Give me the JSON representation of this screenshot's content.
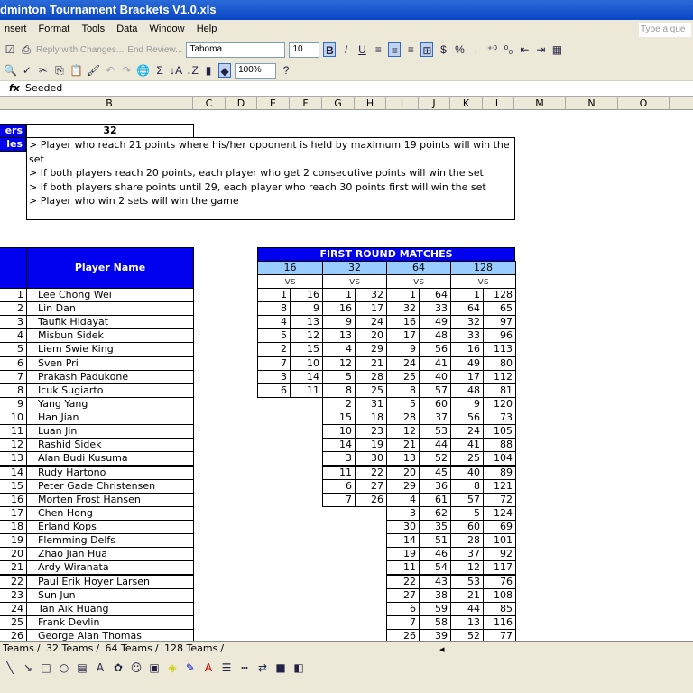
{
  "window": {
    "title": "dminton Tournament Brackets V1.0.xls",
    "help_placeholder": "Type a que"
  },
  "menu": [
    "nsert",
    "Format",
    "Tools",
    "Data",
    "Window",
    "Help"
  ],
  "toolbar": {
    "reply": "Reply with Changes...",
    "end_review": "End Review...",
    "font": "Tahoma",
    "size": "10",
    "zoom": "100%"
  },
  "formula_bar": {
    "fx": "fx",
    "value": "Seeded"
  },
  "columns": [
    "B",
    "C",
    "D",
    "E",
    "F",
    "G",
    "H",
    "I",
    "J",
    "K",
    "L",
    "M",
    "N",
    "O"
  ],
  "players_label": "ers",
  "players_value": "32",
  "rules_label": "les",
  "rules": [
    "> Player who reach 21 points where his/her opponent is held by maximum 19 points will win the set",
    "> If both players reach 20 points, each player who get 2 consecutive points will win the set",
    "> If both players share points until 29, each player who reach 30 points first will win the set",
    "> Player who win 2 sets will win the game"
  ],
  "player_header": "Player Name",
  "players": [
    "Lee Chong Wei",
    "Lin Dan",
    "Taufik Hidayat",
    "Misbun Sidek",
    "Liem Swie King",
    "Sven Pri",
    "Prakash Padukone",
    "Icuk Sugiarto",
    "Yang Yang",
    "Han Jian",
    "Luan Jin",
    "Rashid Sidek",
    "Alan Budi Kusuma",
    "Rudy Hartono",
    "Peter Gade Christensen",
    "Morten Frost Hansen",
    "Chen Hong",
    "Erland Kops",
    "Flemming Delfs",
    "Zhao Jian Hua",
    "Ardy Wiranata",
    "Paul Erik Hoyer Larsen",
    "Sun Jun",
    "Tan Aik Huang",
    "Frank Devlin",
    "George Alan Thomas"
  ],
  "matches": {
    "title": "FIRST ROUND MATCHES",
    "vs": "vs",
    "groups": [
      {
        "label": "16",
        "pairs": [
          [
            1,
            16
          ],
          [
            8,
            9
          ],
          [
            4,
            13
          ],
          [
            5,
            12
          ],
          [
            2,
            15
          ],
          [
            7,
            10
          ],
          [
            3,
            14
          ],
          [
            6,
            11
          ]
        ]
      },
      {
        "label": "32",
        "pairs": [
          [
            1,
            32
          ],
          [
            16,
            17
          ],
          [
            9,
            24
          ],
          [
            13,
            20
          ],
          [
            4,
            29
          ],
          [
            12,
            21
          ],
          [
            5,
            28
          ],
          [
            8,
            25
          ],
          [
            2,
            31
          ],
          [
            15,
            18
          ],
          [
            10,
            23
          ],
          [
            14,
            19
          ],
          [
            3,
            30
          ],
          [
            11,
            22
          ],
          [
            6,
            27
          ],
          [
            7,
            26
          ]
        ]
      },
      {
        "label": "64",
        "pairs": [
          [
            1,
            64
          ],
          [
            32,
            33
          ],
          [
            16,
            49
          ],
          [
            17,
            48
          ],
          [
            9,
            56
          ],
          [
            24,
            41
          ],
          [
            25,
            40
          ],
          [
            8,
            57
          ],
          [
            5,
            60
          ],
          [
            28,
            37
          ],
          [
            12,
            53
          ],
          [
            21,
            44
          ],
          [
            13,
            52
          ],
          [
            20,
            45
          ],
          [
            29,
            36
          ],
          [
            4,
            61
          ],
          [
            3,
            62
          ],
          [
            30,
            35
          ],
          [
            14,
            51
          ],
          [
            19,
            46
          ],
          [
            11,
            54
          ],
          [
            22,
            43
          ],
          [
            27,
            38
          ],
          [
            6,
            59
          ],
          [
            7,
            58
          ],
          [
            26,
            39
          ]
        ]
      },
      {
        "label": "128",
        "pairs": [
          [
            1,
            128
          ],
          [
            64,
            65
          ],
          [
            32,
            97
          ],
          [
            33,
            96
          ],
          [
            16,
            113
          ],
          [
            49,
            80
          ],
          [
            17,
            112
          ],
          [
            48,
            81
          ],
          [
            9,
            120
          ],
          [
            56,
            73
          ],
          [
            24,
            105
          ],
          [
            41,
            88
          ],
          [
            25,
            104
          ],
          [
            40,
            89
          ],
          [
            8,
            121
          ],
          [
            57,
            72
          ],
          [
            5,
            124
          ],
          [
            60,
            69
          ],
          [
            28,
            101
          ],
          [
            37,
            92
          ],
          [
            12,
            117
          ],
          [
            53,
            76
          ],
          [
            21,
            108
          ],
          [
            44,
            85
          ],
          [
            13,
            116
          ],
          [
            52,
            77
          ]
        ]
      }
    ]
  },
  "sheet_tabs": [
    "Teams",
    "32 Teams",
    "64 Teams",
    "128 Teams"
  ],
  "colors": {
    "header_blue": "#0000ee",
    "light_blue": "#99ccff"
  }
}
